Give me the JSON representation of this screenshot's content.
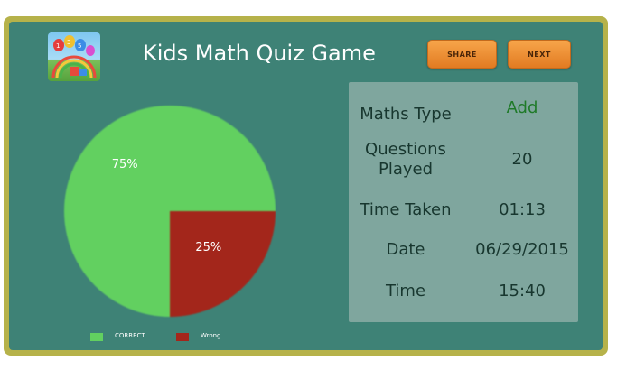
{
  "header": {
    "title": "Kids Math Quiz Game",
    "share_label": "SHARE",
    "next_label": "NEXT"
  },
  "chart_data": {
    "type": "pie",
    "slices": [
      {
        "name": "CORRECT",
        "value": 75,
        "label": "75%",
        "color": "#62d060"
      },
      {
        "name": "Wrong",
        "value": 25,
        "label": "25%",
        "color": "#a3261b"
      }
    ],
    "legend_placement": "bottom-left"
  },
  "legend": [
    {
      "label": "CORRECT",
      "color": "#62d060"
    },
    {
      "label": "Wrong",
      "color": "#a3261b"
    }
  ],
  "stats": [
    {
      "label_lines": [
        "Maths Type"
      ],
      "value": "Add",
      "accent": true
    },
    {
      "label_lines": [
        "Questions",
        "Played"
      ],
      "value": "20",
      "accent": false
    },
    {
      "label_lines": [
        "Time Taken"
      ],
      "value": "01:13",
      "accent": false
    },
    {
      "label_lines": [
        "Date"
      ],
      "value": "06/29/2015",
      "accent": false
    },
    {
      "label_lines": [
        "Time"
      ],
      "value": "15:40",
      "accent": false
    }
  ],
  "colors": {
    "board": "#3e8276",
    "frame": "#b6b24a",
    "stats_panel": "#7fa69e",
    "button": "#f0922f"
  },
  "icons": {
    "logo": "kids-numbers-balloons-logo"
  }
}
